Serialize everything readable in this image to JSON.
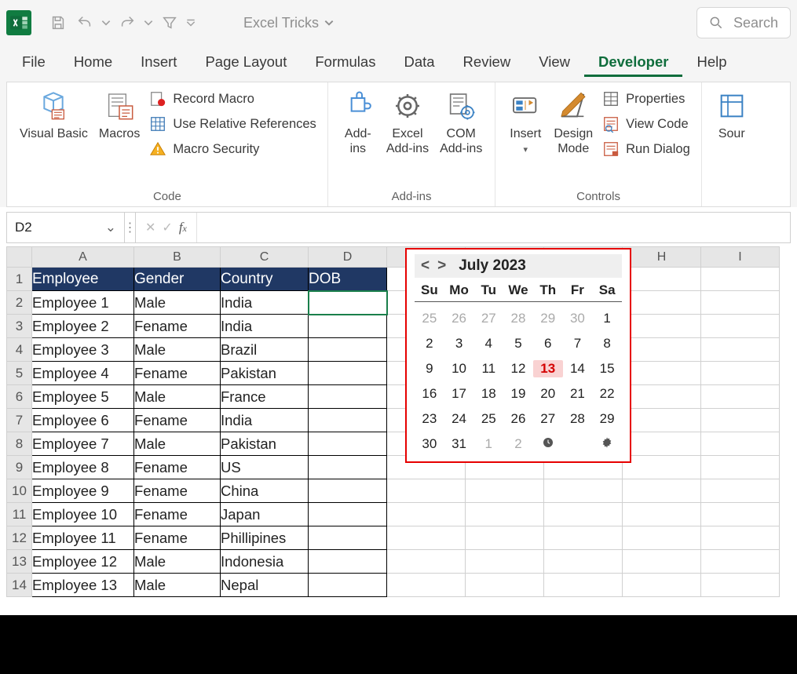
{
  "document_name": "Excel Tricks",
  "search_placeholder": "Search",
  "tabs": [
    "File",
    "Home",
    "Insert",
    "Page Layout",
    "Formulas",
    "Data",
    "Review",
    "View",
    "Developer",
    "Help"
  ],
  "active_tab": "Developer",
  "ribbon": {
    "code": {
      "label": "Code",
      "visual_basic": "Visual Basic",
      "macros": "Macros",
      "record_macro": "Record Macro",
      "use_relative": "Use Relative References",
      "macro_security": "Macro Security"
    },
    "addins": {
      "label": "Add-ins",
      "addins": "Add-\nins",
      "excel_addins": "Excel\nAdd-ins",
      "com_addins": "COM\nAdd-ins"
    },
    "controls": {
      "label": "Controls",
      "insert": "Insert",
      "design_mode": "Design\nMode",
      "properties": "Properties",
      "view_code": "View Code",
      "run_dialog": "Run Dialog"
    },
    "xml": {
      "source": "Sour"
    }
  },
  "namebox": "D2",
  "columns": [
    "A",
    "B",
    "C",
    "D",
    "E",
    "F",
    "G",
    "H",
    "I"
  ],
  "header_row": {
    "a": "Employee",
    "b": "Gender",
    "c": "Country",
    "d": "DOB"
  },
  "rows": [
    {
      "a": "Employee 1",
      "b": "Male",
      "c": "India",
      "d": ""
    },
    {
      "a": "Employee 2",
      "b": "Fename",
      "c": "India",
      "d": ""
    },
    {
      "a": "Employee 3",
      "b": "Male",
      "c": "Brazil",
      "d": ""
    },
    {
      "a": "Employee 4",
      "b": "Fename",
      "c": "Pakistan",
      "d": ""
    },
    {
      "a": "Employee 5",
      "b": "Male",
      "c": "France",
      "d": ""
    },
    {
      "a": "Employee 6",
      "b": "Fename",
      "c": "India",
      "d": ""
    },
    {
      "a": "Employee 7",
      "b": "Male",
      "c": "Pakistan",
      "d": ""
    },
    {
      "a": "Employee 8",
      "b": "Fename",
      "c": "US",
      "d": ""
    },
    {
      "a": "Employee 9",
      "b": "Fename",
      "c": "China",
      "d": ""
    },
    {
      "a": "Employee 10",
      "b": "Fename",
      "c": "Japan",
      "d": ""
    },
    {
      "a": "Employee 11",
      "b": "Fename",
      "c": "Phillipines",
      "d": ""
    },
    {
      "a": "Employee 12",
      "b": "Male",
      "c": "Indonesia",
      "d": ""
    },
    {
      "a": "Employee 13",
      "b": "Male",
      "c": "Nepal",
      "d": ""
    }
  ],
  "calendar": {
    "prev": "<",
    "next": ">",
    "title": "July 2023",
    "dow": [
      "Su",
      "Mo",
      "Tu",
      "We",
      "Th",
      "Fr",
      "Sa"
    ],
    "cells": [
      {
        "n": "25",
        "o": true
      },
      {
        "n": "26",
        "o": true
      },
      {
        "n": "27",
        "o": true
      },
      {
        "n": "28",
        "o": true
      },
      {
        "n": "29",
        "o": true
      },
      {
        "n": "30",
        "o": true
      },
      {
        "n": "1"
      },
      {
        "n": "2"
      },
      {
        "n": "3"
      },
      {
        "n": "4"
      },
      {
        "n": "5"
      },
      {
        "n": "6"
      },
      {
        "n": "7"
      },
      {
        "n": "8"
      },
      {
        "n": "9"
      },
      {
        "n": "10"
      },
      {
        "n": "11"
      },
      {
        "n": "12"
      },
      {
        "n": "13",
        "t": true
      },
      {
        "n": "14"
      },
      {
        "n": "15"
      },
      {
        "n": "16"
      },
      {
        "n": "17"
      },
      {
        "n": "18"
      },
      {
        "n": "19"
      },
      {
        "n": "20"
      },
      {
        "n": "21"
      },
      {
        "n": "22"
      },
      {
        "n": "23"
      },
      {
        "n": "24"
      },
      {
        "n": "25"
      },
      {
        "n": "26"
      },
      {
        "n": "27"
      },
      {
        "n": "28"
      },
      {
        "n": "29"
      },
      {
        "n": "30"
      },
      {
        "n": "31"
      },
      {
        "n": "1",
        "o": true
      },
      {
        "n": "2",
        "o": true
      },
      {
        "icon": "clock"
      },
      {
        "n": ""
      },
      {
        "icon": "gear"
      }
    ]
  }
}
